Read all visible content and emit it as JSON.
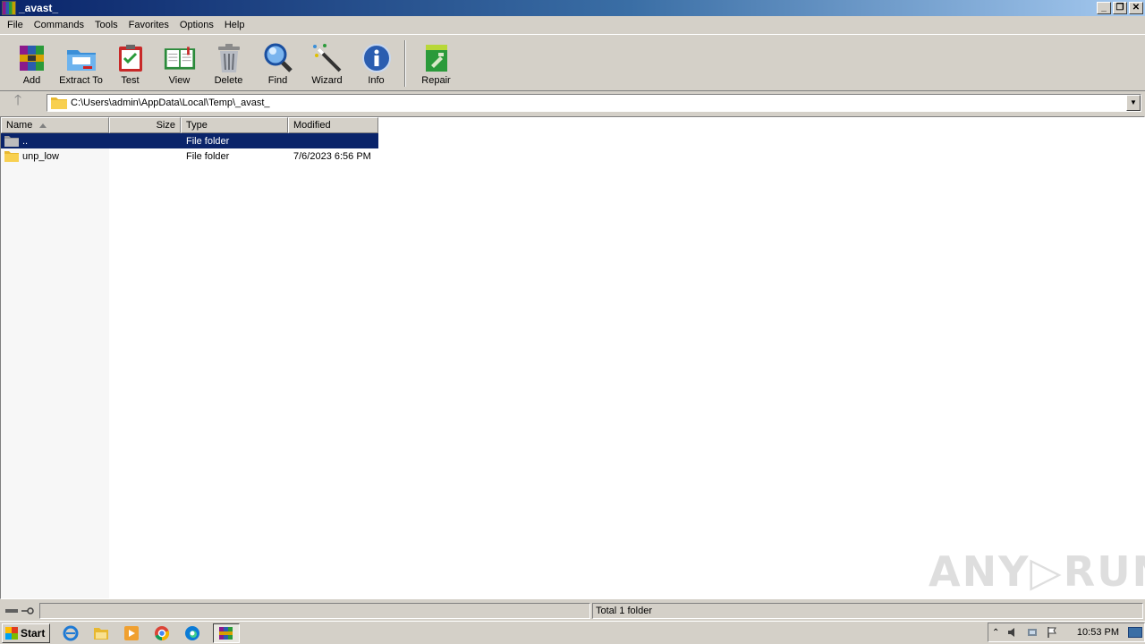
{
  "window": {
    "title": "_avast_",
    "controls": [
      "_",
      "❐",
      "✕"
    ]
  },
  "menu": [
    "File",
    "Commands",
    "Tools",
    "Favorites",
    "Options",
    "Help"
  ],
  "toolbar": [
    {
      "label": "Add",
      "icon": "add-archive-icon"
    },
    {
      "label": "Extract To",
      "icon": "extract-folder-icon"
    },
    {
      "label": "Test",
      "icon": "test-clipboard-icon"
    },
    {
      "label": "View",
      "icon": "view-book-icon"
    },
    {
      "label": "Delete",
      "icon": "trash-can-icon"
    },
    {
      "label": "Find",
      "icon": "magnifier-icon"
    },
    {
      "label": "Wizard",
      "icon": "magic-wand-icon"
    },
    {
      "label": "Info",
      "icon": "info-icon"
    },
    {
      "label": "Repair",
      "icon": "repair-kit-icon"
    }
  ],
  "address": {
    "path": "C:\\Users\\admin\\AppData\\Local\\Temp\\_avast_"
  },
  "columns": {
    "name": "Name",
    "size": "Size",
    "type": "Type",
    "modified": "Modified"
  },
  "files": [
    {
      "name": "..",
      "size": "",
      "type": "File folder",
      "modified": "",
      "selected": true
    },
    {
      "name": "unp_low",
      "size": "",
      "type": "File folder",
      "modified": "7/6/2023 6:56 PM",
      "selected": false
    }
  ],
  "status": {
    "summary": "Total 1 folder"
  },
  "taskbar": {
    "start_label": "Start",
    "clock": "10:53 PM"
  },
  "watermark": "ANY▷RUN",
  "colors": {
    "selection": "#0a246a",
    "face": "#d4d0c8"
  }
}
